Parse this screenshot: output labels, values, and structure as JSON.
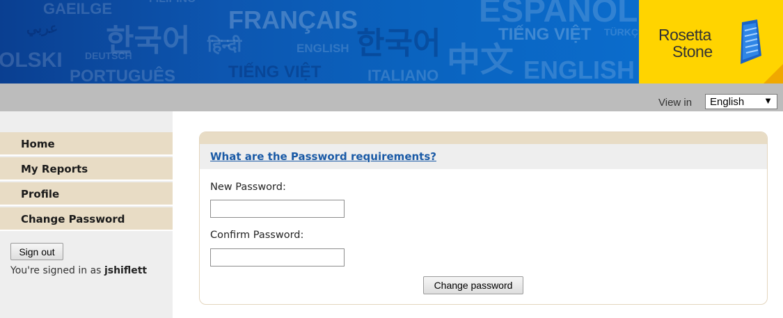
{
  "banner": {
    "words": [
      {
        "text": "GAEILGE"
      },
      {
        "text": "FILIPINO"
      },
      {
        "text": "عربي"
      },
      {
        "text": "한국어"
      },
      {
        "text": "FRANÇAIS"
      },
      {
        "text": "हिन्दी"
      },
      {
        "text": "한국어"
      },
      {
        "text": "ESPAÑOL"
      },
      {
        "text": "TIẾNG VIỆT"
      },
      {
        "text": "TÜRKÇE"
      },
      {
        "text": "OLSKI"
      },
      {
        "text": "DEUTSCH"
      },
      {
        "text": "ENGLISH"
      },
      {
        "text": "中文"
      },
      {
        "text": "PORTUGUÊS"
      },
      {
        "text": "TIẾNG VIỆT"
      },
      {
        "text": "ITALIANO"
      },
      {
        "text": "ENGLISH"
      }
    ]
  },
  "logo": {
    "line1": "Rosetta",
    "line2": "Stone",
    "brand_color": "#ffd400",
    "icon": "rosetta-stone-logo-icon"
  },
  "view_in": {
    "label": "View in",
    "selected": "English"
  },
  "sidebar": {
    "items": [
      {
        "label": "Home"
      },
      {
        "label": "My Reports"
      },
      {
        "label": "Profile"
      },
      {
        "label": "Change Password"
      }
    ],
    "signout_label": "Sign out",
    "signed_in_prefix": "You're signed in as",
    "username": "jshiflett"
  },
  "form": {
    "requirements_link": "What are the Password requirements?",
    "new_password_label": "New Password:",
    "new_password_value": "",
    "confirm_password_label": "Confirm Password:",
    "confirm_password_value": "",
    "submit_label": "Change password"
  },
  "colors": {
    "nav_bg": "#e8dcc5",
    "link": "#1a5aa6",
    "banner_blue": "#0b5cb8"
  }
}
